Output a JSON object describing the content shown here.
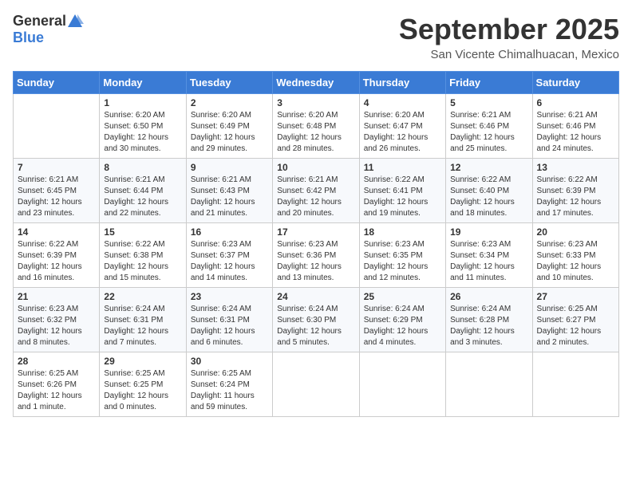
{
  "logo": {
    "general": "General",
    "blue": "Blue"
  },
  "title": "September 2025",
  "location": "San Vicente Chimalhuacan, Mexico",
  "weekdays": [
    "Sunday",
    "Monday",
    "Tuesday",
    "Wednesday",
    "Thursday",
    "Friday",
    "Saturday"
  ],
  "weeks": [
    [
      {
        "day": "",
        "info": ""
      },
      {
        "day": "1",
        "info": "Sunrise: 6:20 AM\nSunset: 6:50 PM\nDaylight: 12 hours\nand 30 minutes."
      },
      {
        "day": "2",
        "info": "Sunrise: 6:20 AM\nSunset: 6:49 PM\nDaylight: 12 hours\nand 29 minutes."
      },
      {
        "day": "3",
        "info": "Sunrise: 6:20 AM\nSunset: 6:48 PM\nDaylight: 12 hours\nand 28 minutes."
      },
      {
        "day": "4",
        "info": "Sunrise: 6:20 AM\nSunset: 6:47 PM\nDaylight: 12 hours\nand 26 minutes."
      },
      {
        "day": "5",
        "info": "Sunrise: 6:21 AM\nSunset: 6:46 PM\nDaylight: 12 hours\nand 25 minutes."
      },
      {
        "day": "6",
        "info": "Sunrise: 6:21 AM\nSunset: 6:46 PM\nDaylight: 12 hours\nand 24 minutes."
      }
    ],
    [
      {
        "day": "7",
        "info": "Sunrise: 6:21 AM\nSunset: 6:45 PM\nDaylight: 12 hours\nand 23 minutes."
      },
      {
        "day": "8",
        "info": "Sunrise: 6:21 AM\nSunset: 6:44 PM\nDaylight: 12 hours\nand 22 minutes."
      },
      {
        "day": "9",
        "info": "Sunrise: 6:21 AM\nSunset: 6:43 PM\nDaylight: 12 hours\nand 21 minutes."
      },
      {
        "day": "10",
        "info": "Sunrise: 6:21 AM\nSunset: 6:42 PM\nDaylight: 12 hours\nand 20 minutes."
      },
      {
        "day": "11",
        "info": "Sunrise: 6:22 AM\nSunset: 6:41 PM\nDaylight: 12 hours\nand 19 minutes."
      },
      {
        "day": "12",
        "info": "Sunrise: 6:22 AM\nSunset: 6:40 PM\nDaylight: 12 hours\nand 18 minutes."
      },
      {
        "day": "13",
        "info": "Sunrise: 6:22 AM\nSunset: 6:39 PM\nDaylight: 12 hours\nand 17 minutes."
      }
    ],
    [
      {
        "day": "14",
        "info": "Sunrise: 6:22 AM\nSunset: 6:39 PM\nDaylight: 12 hours\nand 16 minutes."
      },
      {
        "day": "15",
        "info": "Sunrise: 6:22 AM\nSunset: 6:38 PM\nDaylight: 12 hours\nand 15 minutes."
      },
      {
        "day": "16",
        "info": "Sunrise: 6:23 AM\nSunset: 6:37 PM\nDaylight: 12 hours\nand 14 minutes."
      },
      {
        "day": "17",
        "info": "Sunrise: 6:23 AM\nSunset: 6:36 PM\nDaylight: 12 hours\nand 13 minutes."
      },
      {
        "day": "18",
        "info": "Sunrise: 6:23 AM\nSunset: 6:35 PM\nDaylight: 12 hours\nand 12 minutes."
      },
      {
        "day": "19",
        "info": "Sunrise: 6:23 AM\nSunset: 6:34 PM\nDaylight: 12 hours\nand 11 minutes."
      },
      {
        "day": "20",
        "info": "Sunrise: 6:23 AM\nSunset: 6:33 PM\nDaylight: 12 hours\nand 10 minutes."
      }
    ],
    [
      {
        "day": "21",
        "info": "Sunrise: 6:23 AM\nSunset: 6:32 PM\nDaylight: 12 hours\nand 8 minutes."
      },
      {
        "day": "22",
        "info": "Sunrise: 6:24 AM\nSunset: 6:31 PM\nDaylight: 12 hours\nand 7 minutes."
      },
      {
        "day": "23",
        "info": "Sunrise: 6:24 AM\nSunset: 6:31 PM\nDaylight: 12 hours\nand 6 minutes."
      },
      {
        "day": "24",
        "info": "Sunrise: 6:24 AM\nSunset: 6:30 PM\nDaylight: 12 hours\nand 5 minutes."
      },
      {
        "day": "25",
        "info": "Sunrise: 6:24 AM\nSunset: 6:29 PM\nDaylight: 12 hours\nand 4 minutes."
      },
      {
        "day": "26",
        "info": "Sunrise: 6:24 AM\nSunset: 6:28 PM\nDaylight: 12 hours\nand 3 minutes."
      },
      {
        "day": "27",
        "info": "Sunrise: 6:25 AM\nSunset: 6:27 PM\nDaylight: 12 hours\nand 2 minutes."
      }
    ],
    [
      {
        "day": "28",
        "info": "Sunrise: 6:25 AM\nSunset: 6:26 PM\nDaylight: 12 hours\nand 1 minute."
      },
      {
        "day": "29",
        "info": "Sunrise: 6:25 AM\nSunset: 6:25 PM\nDaylight: 12 hours\nand 0 minutes."
      },
      {
        "day": "30",
        "info": "Sunrise: 6:25 AM\nSunset: 6:24 PM\nDaylight: 11 hours\nand 59 minutes."
      },
      {
        "day": "",
        "info": ""
      },
      {
        "day": "",
        "info": ""
      },
      {
        "day": "",
        "info": ""
      },
      {
        "day": "",
        "info": ""
      }
    ]
  ]
}
